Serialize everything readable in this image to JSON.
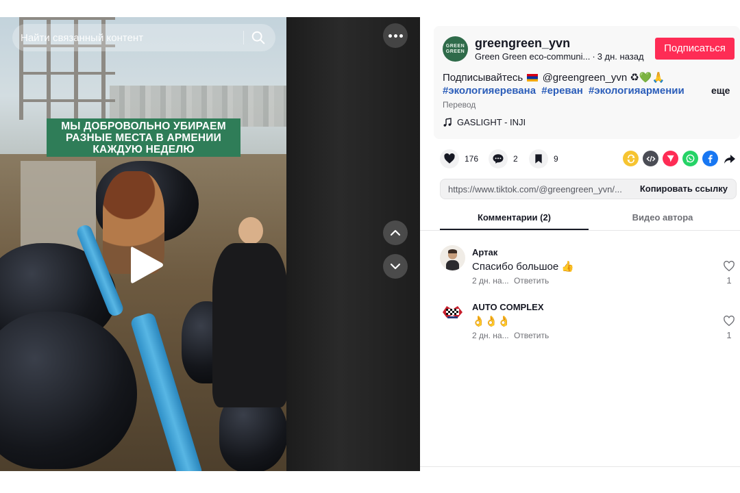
{
  "video": {
    "search_placeholder": "Найти связанный контент",
    "overlay_caption_lines": [
      "МЫ ДОБРОВОЛЬНО УБИРАЕМ",
      "РАЗНЫЕ МЕСТА В АРМЕНИИ",
      "КАЖДУЮ НЕДЕЛЮ"
    ],
    "icons": [
      "search-icon",
      "more-icon",
      "play-icon",
      "chevron-up-icon",
      "chevron-down-icon"
    ]
  },
  "author": {
    "avatar_text": "GREEN GREEN",
    "username": "greengreen_yvn",
    "nickname": "Green Green eco-communi...",
    "time_ago": "3 дн. назад",
    "subscribe_label": "Подписаться"
  },
  "post": {
    "description_prefix": "Подписывайтесь",
    "description_handle": "@greengreen_yvn",
    "description_emoji": "♻💚🙏",
    "hashtags": [
      "#экологияеревана",
      "#ереван",
      "#экологияармении"
    ],
    "more_label": "еще",
    "translate_label": "Перевод",
    "music": "GASLIGHT - INJI"
  },
  "stats": {
    "likes": "176",
    "comments": "2",
    "bookmarks": "9"
  },
  "share": {
    "url": "https://www.tiktok.com/@greengreen_yvn/...",
    "copy_label": "Копировать ссылку",
    "colors": {
      "repost": "#f6c431",
      "embed": "#4b4d55",
      "direct": "#fe2c55",
      "whatsapp": "#25d366",
      "facebook": "#1877f2"
    }
  },
  "tabs": {
    "comments": "Комментарии (2)",
    "author_videos": "Видео автора"
  },
  "comments": [
    {
      "name": "Артак",
      "text": "Спасибо большое 👍",
      "time": "2 дн. на...",
      "reply": "Ответить",
      "likes": "1"
    },
    {
      "name": "AUTO COMPLEX",
      "text": "👌👌👌",
      "time": "2 дн. на...",
      "reply": "Ответить",
      "likes": "1"
    }
  ]
}
